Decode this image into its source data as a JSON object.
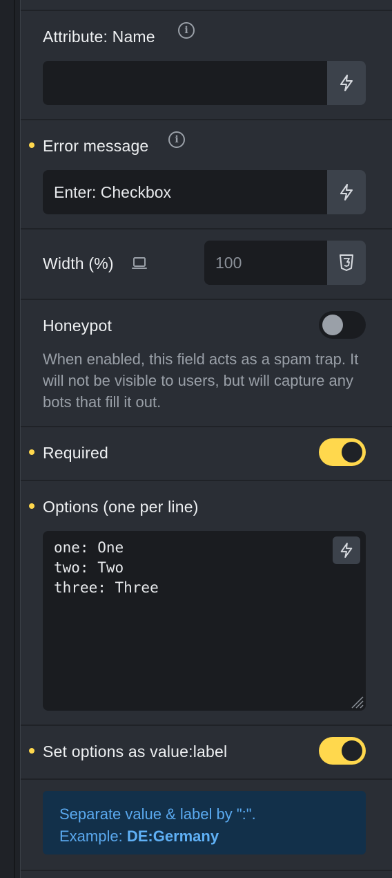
{
  "fields": {
    "attribute_name": {
      "label": "Attribute: Name",
      "value": ""
    },
    "error_message": {
      "label": "Error message",
      "value": "Enter: Checkbox"
    },
    "width": {
      "label": "Width (%)",
      "placeholder": "100"
    },
    "honeypot": {
      "label": "Honeypot",
      "enabled": false,
      "description": "When enabled, this field acts as a spam trap. It will not be visible to users, but will capture any bots that fill it out."
    },
    "required": {
      "label": "Required",
      "enabled": true
    },
    "options": {
      "label": "Options (one per line)",
      "lines": [
        "one: One",
        "two: Two",
        "three: Three"
      ]
    },
    "value_label": {
      "label": "Set options as value:label",
      "enabled": true
    },
    "hint": {
      "line1": "Separate value & label by \":\".",
      "line2_prefix": "Example: ",
      "line2_bold": "DE:Germany"
    }
  },
  "colors": {
    "accent": "#ffd84d",
    "panel_bg": "#2a2e35",
    "input_bg": "#1a1c20",
    "info_bg": "#12304a",
    "info_text": "#5aa9ef"
  },
  "icons": {
    "dynamic_data": "lightning-icon",
    "info": "info-icon",
    "breakpoint": "laptop-icon",
    "css": "css3-icon"
  }
}
